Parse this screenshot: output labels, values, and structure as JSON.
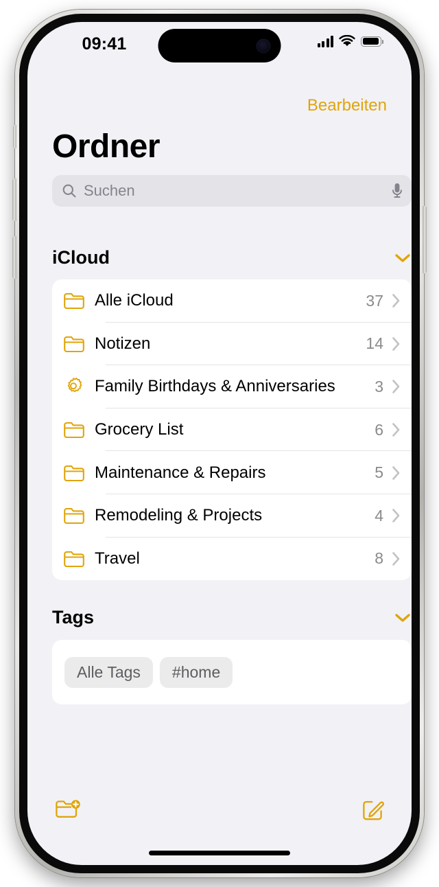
{
  "status_bar": {
    "time": "09:41",
    "cellular_icon": "cellular-signal-icon",
    "wifi_icon": "wifi-icon",
    "battery_icon": "battery-icon"
  },
  "nav": {
    "edit_label": "Bearbeiten"
  },
  "header": {
    "title": "Ordner"
  },
  "search": {
    "placeholder": "Suchen",
    "value": "",
    "search_icon": "search-icon",
    "mic_icon": "microphone-icon"
  },
  "sections": {
    "icloud": {
      "title": "iCloud",
      "collapse_icon": "chevron-down-icon",
      "rows": [
        {
          "icon": "folder-icon",
          "label": "Alle iCloud",
          "count": "37",
          "disclosure": "chevron-right-icon"
        },
        {
          "icon": "folder-icon",
          "label": "Notizen",
          "count": "14",
          "disclosure": "chevron-right-icon"
        },
        {
          "icon": "gear-icon",
          "label": "Family Birthdays & Anniversaries",
          "count": "3",
          "disclosure": "chevron-right-icon"
        },
        {
          "icon": "folder-icon",
          "label": "Grocery List",
          "count": "6",
          "disclosure": "chevron-right-icon"
        },
        {
          "icon": "folder-icon",
          "label": "Maintenance & Repairs",
          "count": "5",
          "disclosure": "chevron-right-icon"
        },
        {
          "icon": "folder-icon",
          "label": "Remodeling & Projects",
          "count": "4",
          "disclosure": "chevron-right-icon"
        },
        {
          "icon": "folder-icon",
          "label": "Travel",
          "count": "8",
          "disclosure": "chevron-right-icon"
        }
      ]
    },
    "tags": {
      "title": "Tags",
      "collapse_icon": "chevron-down-icon",
      "pills": [
        {
          "label": "Alle Tags"
        },
        {
          "label": "#home"
        }
      ]
    }
  },
  "toolbar": {
    "new_folder_icon": "new-folder-icon",
    "compose_icon": "compose-note-icon"
  },
  "colors": {
    "accent": "#e0a50a",
    "background": "#f2f1f6",
    "card": "#ffffff",
    "secondary_text": "#8a8a8e",
    "search_field": "#e3e3e8",
    "separator": "#e4e4e6",
    "tag_pill": "#ebebeb"
  }
}
